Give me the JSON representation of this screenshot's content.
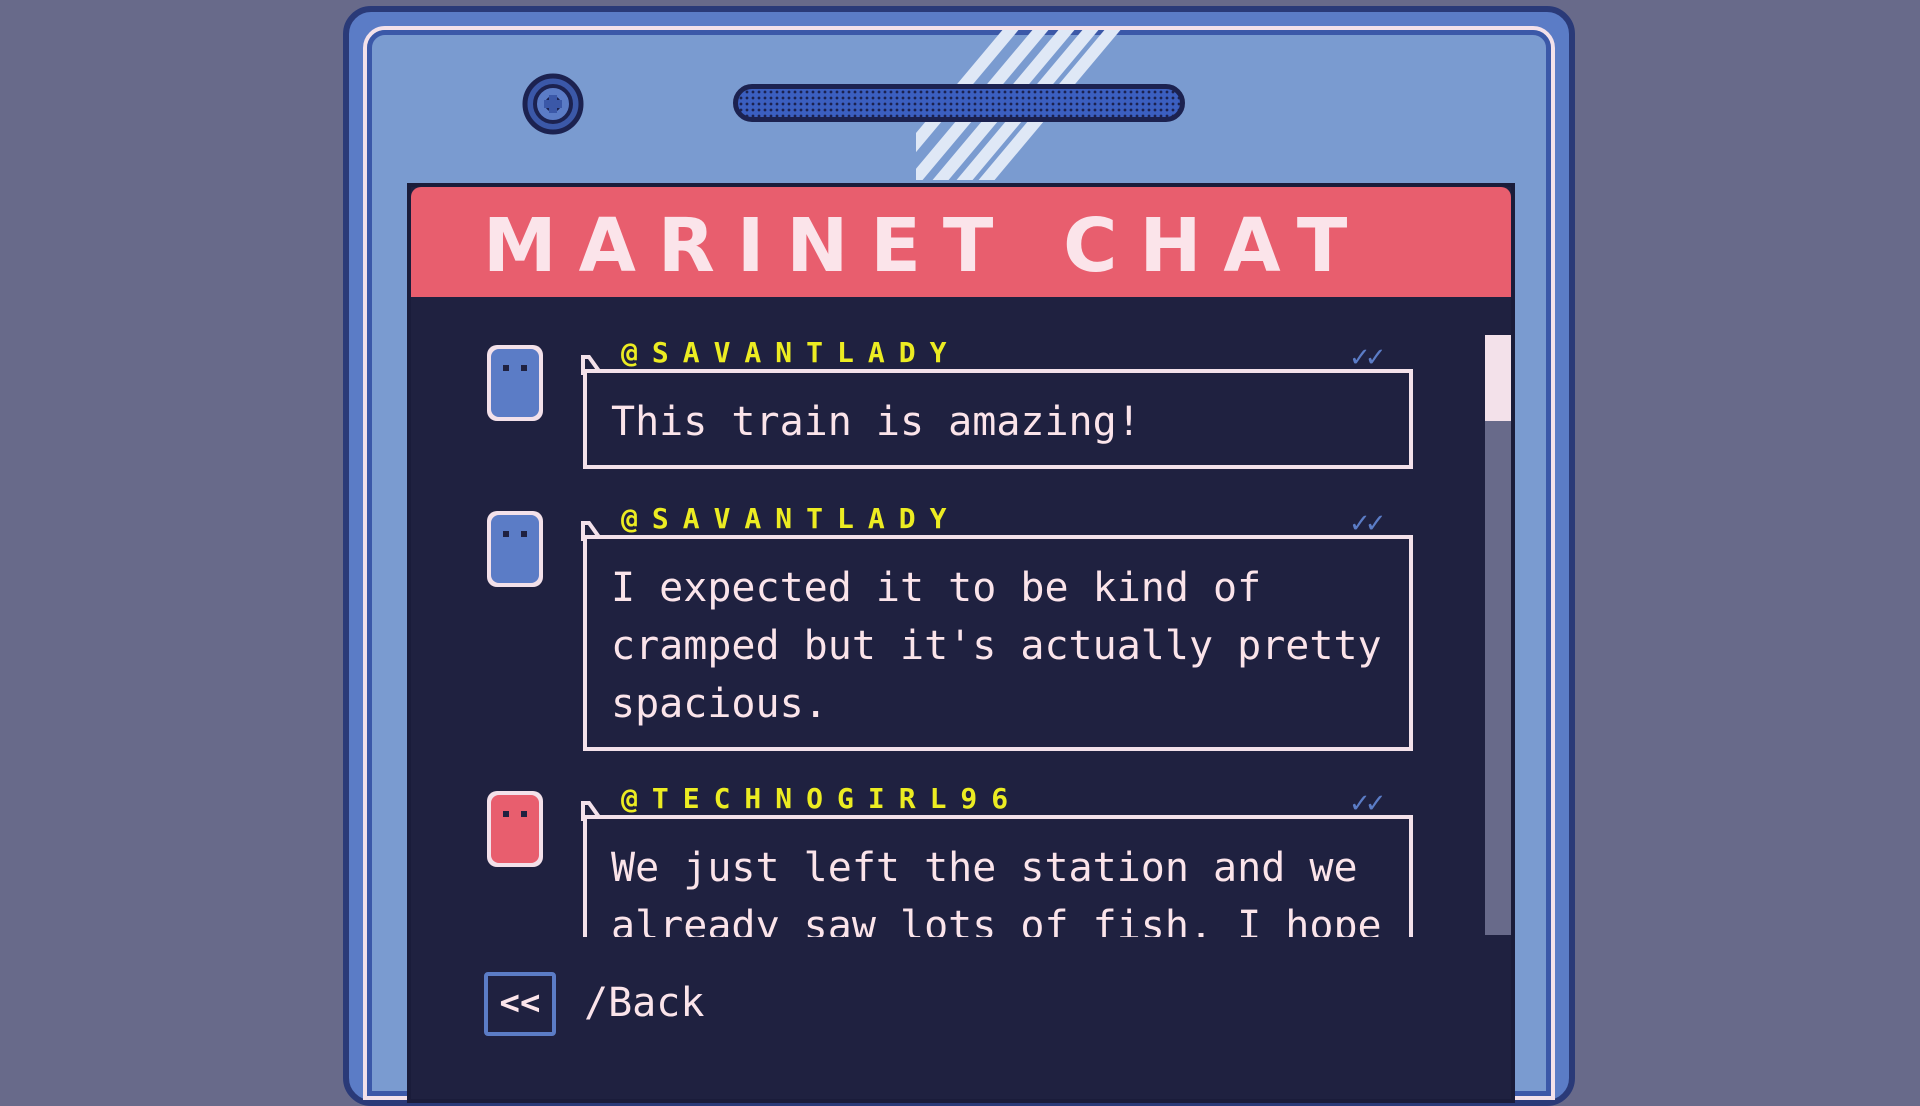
{
  "app": {
    "title": "MARINET CHAT"
  },
  "messages": [
    {
      "handle": "@SAVANTLADY",
      "text": "This train is amazing!",
      "status": "✓✓",
      "avatar_color": "#5b7cc6"
    },
    {
      "handle": "@SAVANTLADY",
      "text": "I expected it to be kind of cramped but it's actually pretty spacious.",
      "status": "✓✓",
      "avatar_color": "#5b7cc6"
    },
    {
      "handle": "@TECHNOGIRL96",
      "text": "We just left the station and we already saw lots of fish. I hope",
      "status": "✓✓",
      "avatar_color": "#e85e6e"
    }
  ],
  "navigation": {
    "back_icon": "<<",
    "back_label": "/Back"
  },
  "colors": {
    "accent": "#e85e6e",
    "handle": "#ecec22",
    "screen": "#1f2140",
    "phone": "#5b7cc6",
    "text": "#fbe4ea"
  },
  "icons": {
    "camera": "camera-icon",
    "read_receipt": "double-check-icon",
    "back": "chevron-left-double-icon"
  }
}
